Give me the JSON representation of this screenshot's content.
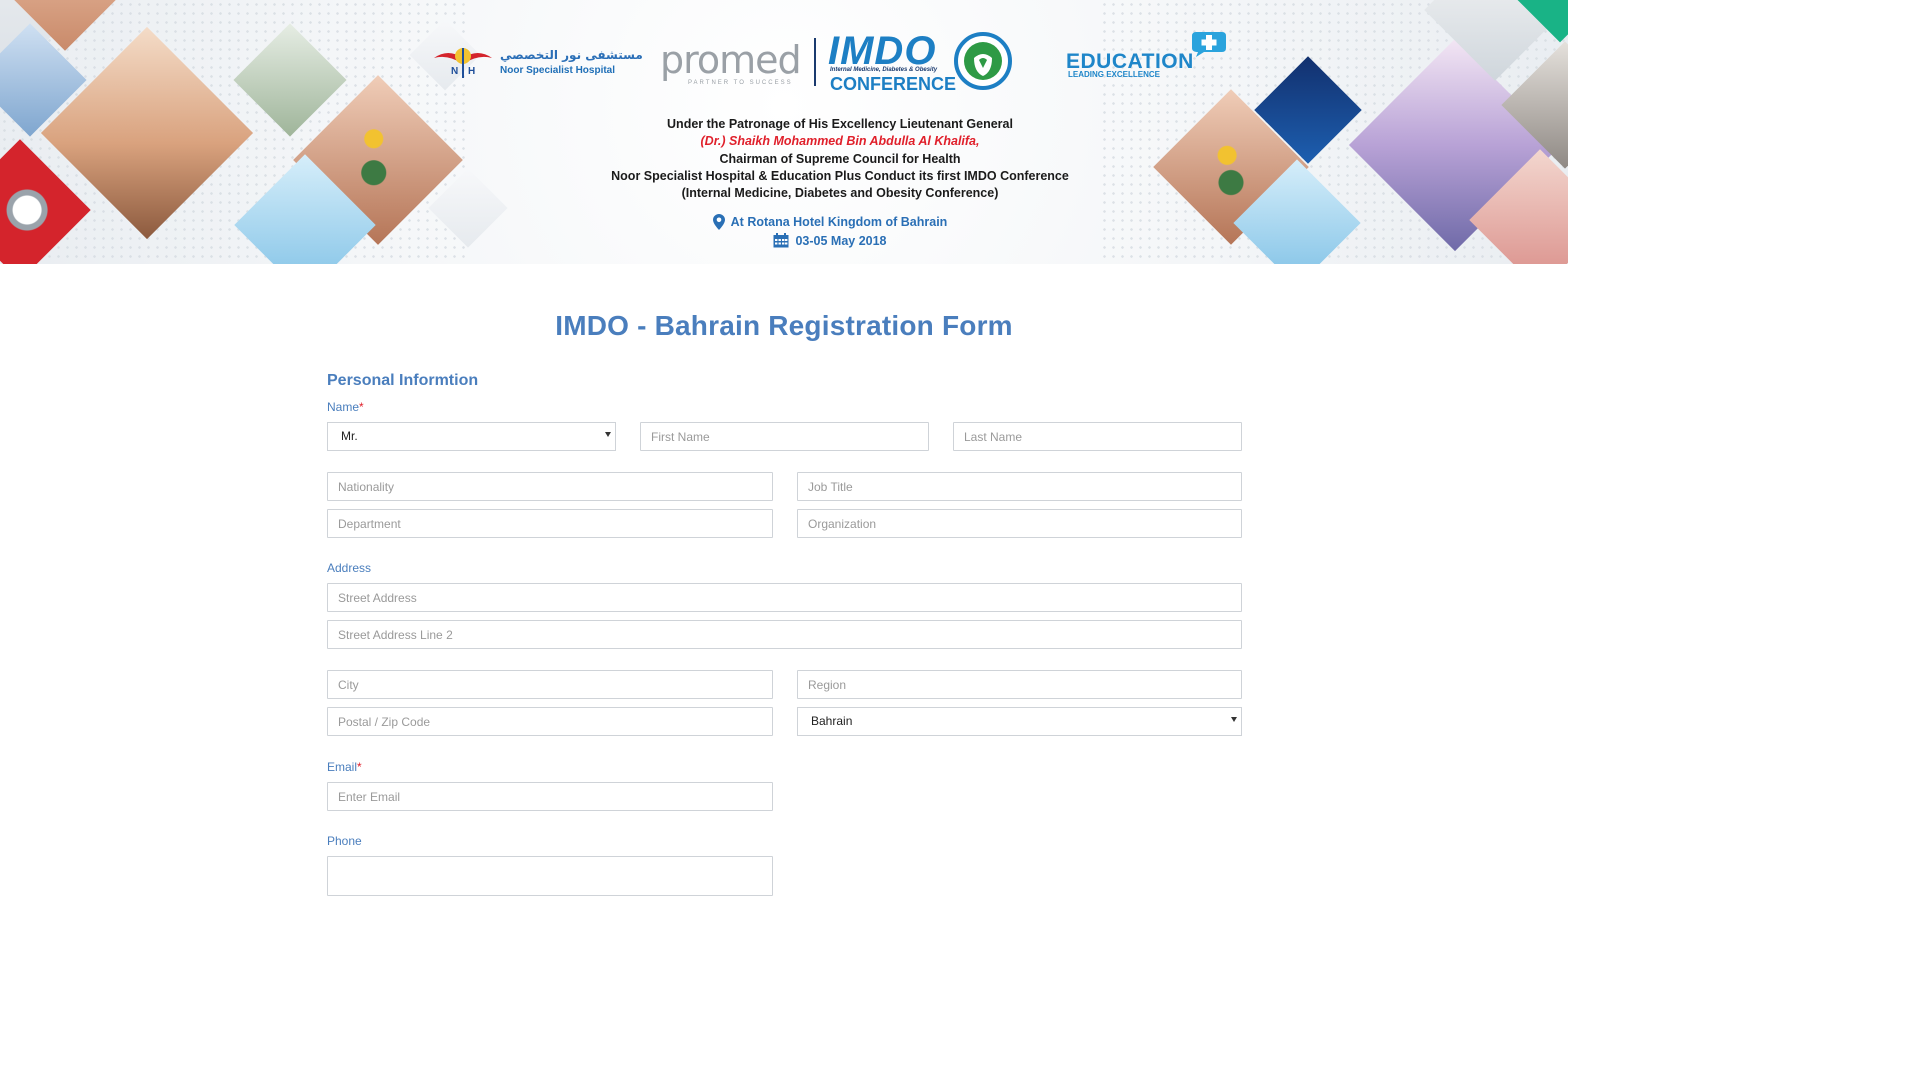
{
  "banner": {
    "hospital_name_arabic": "مستشفى نور التخصصي",
    "hospital_name_english": "Noor Specialist Hospital",
    "hospital_mark": "NSH",
    "promed_logo": "promed",
    "promed_tagline": "PARTNER TO SUCCESS",
    "imdo_logo": "IMDO",
    "imdo_subtitle": "Internal Medicine, Diabetes & Obesity",
    "imdo_conference": "CONFERENCE",
    "education_logo": "EDUCATION",
    "education_tagline": "LEADING EXCELLENCE",
    "patronage_line1": "Under the Patronage of His Excellency Lieutenant General",
    "patronage_name": "(Dr.) Shaikh Mohammed Bin Abdulla Al Khalifa,",
    "patronage_line3": "Chairman of Supreme Council for Health",
    "patronage_line4": "Noor Specialist Hospital & Education Plus  Conduct its first IMDO Conference",
    "patronage_line5": "(Internal Medicine, Diabetes and Obesity Conference)",
    "venue": "At Rotana Hotel Kingdom of Bahrain",
    "dates": "03-05 May 2018",
    "colors": {
      "accent_blue": "#1d7fc4",
      "name_red": "#e0202b"
    }
  },
  "form": {
    "title": "IMDO - Bahrain Registration Form",
    "section_personal": "Personal Informtion",
    "name_label": "Name",
    "required_mark": "*",
    "salutation_value": "Mr.",
    "first_name_placeholder": "First Name",
    "last_name_placeholder": "Last Name",
    "nationality_placeholder": "Nationality",
    "job_title_placeholder": "Job Title",
    "department_placeholder": "Department",
    "organization_placeholder": "Organization",
    "address_label": "Address",
    "street_placeholder": "Street Address",
    "street2_placeholder": "Street Address Line 2",
    "city_placeholder": "City",
    "region_placeholder": "Region",
    "postal_placeholder": "Postal / Zip Code",
    "country_value": "Bahrain",
    "email_label": "Email",
    "email_placeholder": "Enter Email",
    "phone_label": "Phone",
    "colors": {
      "label_blue": "#4a7ebd",
      "required_red": "#e0202b"
    }
  }
}
